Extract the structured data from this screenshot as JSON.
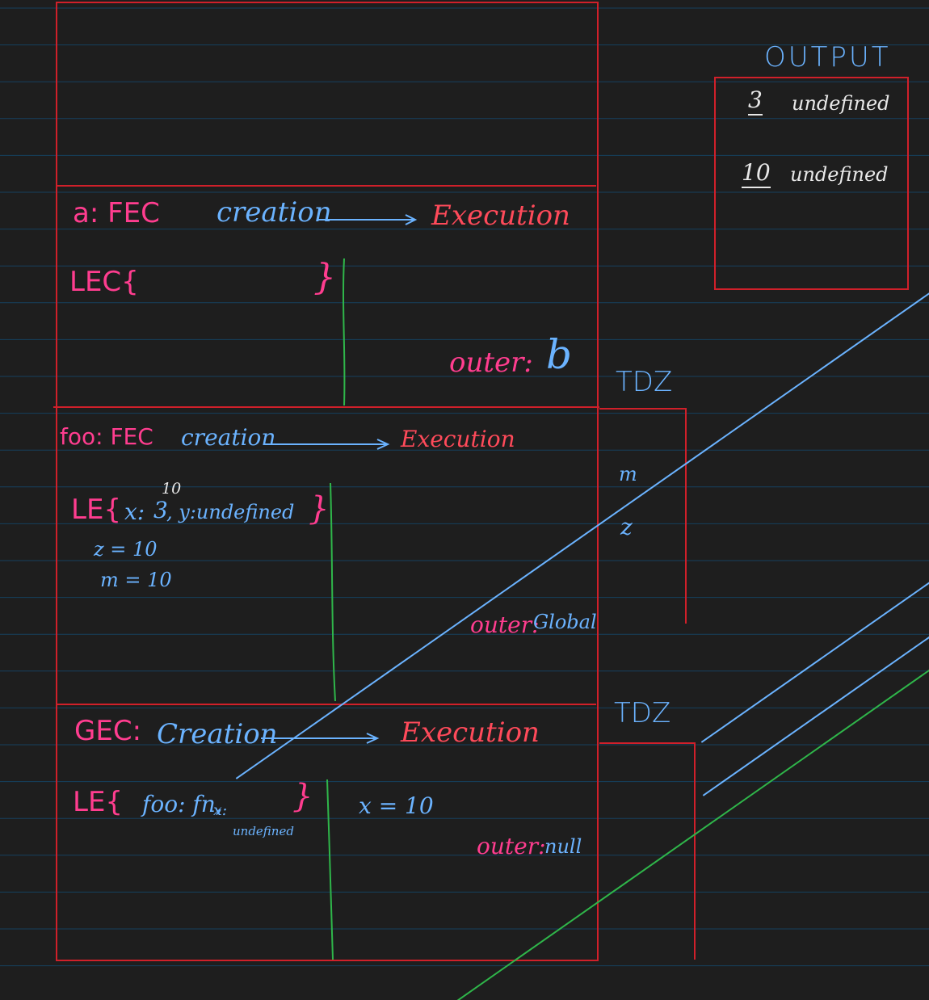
{
  "colors": {
    "background": "#1e1e1e",
    "rule": "#16405f",
    "box": "#d0202a",
    "pink": "#ff3d8f",
    "red": "#ff4a5a",
    "blue": "#6bb3ff",
    "green": "#2fb64a",
    "white": "#e8e8e8"
  },
  "output": {
    "title": "OUTPUT",
    "line1_num": "3",
    "line1_val": "undefined",
    "line2_num": "10",
    "line2_val": "undefined"
  },
  "a_fec": {
    "label": "a: FEC",
    "creation": "creation",
    "execution": "Execution",
    "env_open": "LEC{",
    "env_close": "}",
    "outer_label": "outer:",
    "outer_value": "b"
  },
  "foo_fec": {
    "label": "foo: FEC",
    "creation": "creation",
    "execution": "Execution",
    "env_open": "LE{",
    "x_key": "x:",
    "x_old": "3",
    "x_new": "10",
    "y_entry": ", y:undefined",
    "env_close": "}",
    "z_assign": "z = 10",
    "m_assign": "m = 10",
    "outer_label": "outer:",
    "outer_value": "Global"
  },
  "gec": {
    "label": "GEC:",
    "creation": "Creation",
    "execution": "Execution",
    "env_open": "LE{",
    "foo_entry": "foo: fn,",
    "x_key": "x:",
    "x_old": "undefined",
    "env_close": "}",
    "x_assign": "x = 10",
    "outer_label": "outer:",
    "outer_value": "null"
  },
  "tdz": {
    "label_top": "TDZ",
    "item_m": "m",
    "item_z": "z",
    "label_bottom": "TDZ"
  }
}
